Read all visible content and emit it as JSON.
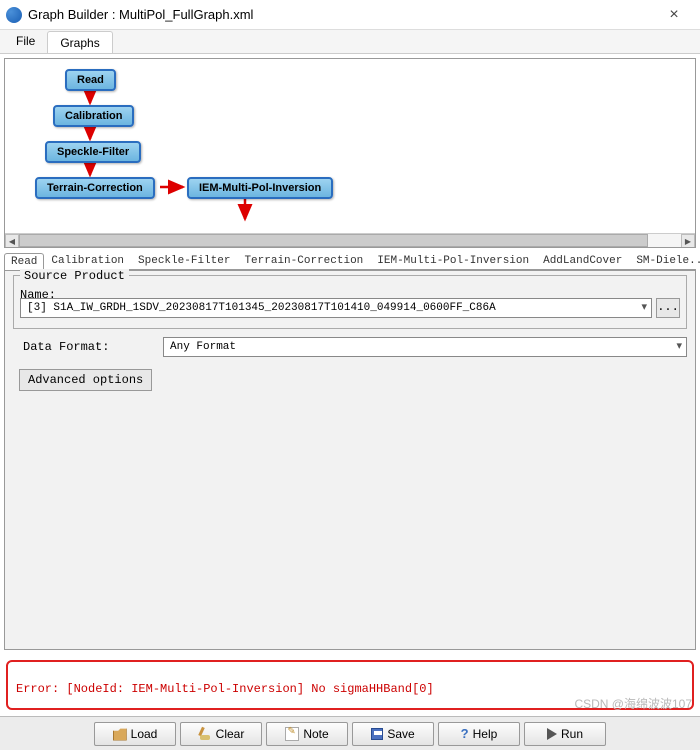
{
  "window": {
    "title": "Graph Builder : MultiPol_FullGraph.xml",
    "close_label": "×"
  },
  "menu": {
    "file": "File",
    "graphs": "Graphs"
  },
  "nodes": {
    "read": "Read",
    "calibration": "Calibration",
    "speckle": "Speckle-Filter",
    "terrain": "Terrain-Correction",
    "iem": "IEM-Multi-Pol-Inversion"
  },
  "tabs": [
    "Read",
    "Calibration",
    "Speckle-Filter",
    "Terrain-Correction",
    "IEM-Multi-Pol-Inversion",
    "AddLandCover",
    "SM-Diele..."
  ],
  "source_panel": {
    "legend": "Source Product",
    "name_label": "Name:",
    "name_value": "[3] S1A_IW_GRDH_1SDV_20230817T101345_20230817T101410_049914_0600FF_C86A",
    "ellipsis": "...",
    "data_format_label": "Data Format:",
    "data_format_value": "Any Format",
    "advanced": "Advanced options"
  },
  "error": {
    "text": "Error: [NodeId: IEM-Multi-Pol-Inversion] No sigmaHHBand[0]"
  },
  "footer": {
    "load": "Load",
    "clear": "Clear",
    "note": "Note",
    "save": "Save",
    "help": "Help",
    "run": "Run"
  },
  "watermark": "CSDN @海绵波波107"
}
